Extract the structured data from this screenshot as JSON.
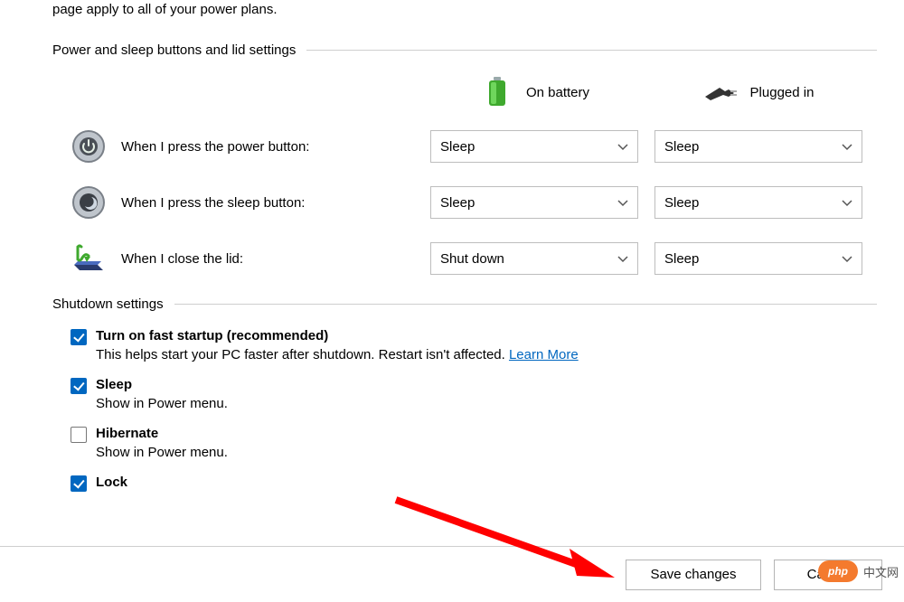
{
  "intro_line": "page apply to all of your power plans.",
  "sections": {
    "power_buttons_title": "Power and sleep buttons and lid settings",
    "shutdown_title": "Shutdown settings"
  },
  "columns": {
    "on_battery": "On battery",
    "plugged_in": "Plugged in"
  },
  "rows": {
    "power_button": {
      "label": "When I press the power button:",
      "battery": "Sleep",
      "plugged": "Sleep"
    },
    "sleep_button": {
      "label": "When I press the sleep button:",
      "battery": "Sleep",
      "plugged": "Sleep"
    },
    "close_lid": {
      "label": "When I close the lid:",
      "battery": "Shut down",
      "plugged": "Sleep"
    }
  },
  "shutdown": {
    "fast_startup": {
      "checked": true,
      "title": "Turn on fast startup (recommended)",
      "desc": "This helps start your PC faster after shutdown. Restart isn't affected. ",
      "learn_more": "Learn More"
    },
    "sleep": {
      "checked": true,
      "title": "Sleep",
      "desc": "Show in Power menu."
    },
    "hibernate": {
      "checked": false,
      "title": "Hibernate",
      "desc": "Show in Power menu."
    },
    "lock": {
      "checked": true,
      "title": "Lock"
    }
  },
  "buttons": {
    "save": "Save changes",
    "cancel": "Cancel"
  },
  "watermark": {
    "badge": "php",
    "text": "中文网"
  }
}
